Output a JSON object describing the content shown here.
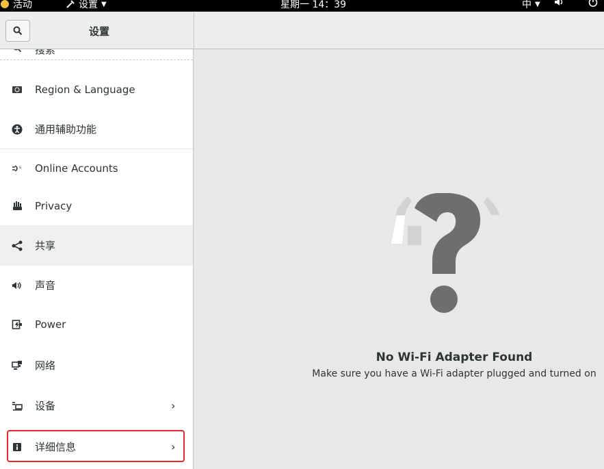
{
  "topbar": {
    "activities": "活动",
    "app_menu": "设置",
    "clock": "星期一 14：39",
    "input_method": "中"
  },
  "header": {
    "title": "设置"
  },
  "sidebar": {
    "items": [
      {
        "label": "搜索",
        "icon": "search-icon"
      },
      {
        "label": "Region & Language",
        "icon": "region-language-icon"
      },
      {
        "label": "通用辅助功能",
        "icon": "accessibility-icon"
      },
      {
        "label": "Online Accounts",
        "icon": "online-accounts-icon"
      },
      {
        "label": "Privacy",
        "icon": "privacy-hand-icon"
      },
      {
        "label": "共享",
        "icon": "share-icon"
      },
      {
        "label": "声音",
        "icon": "sound-icon"
      },
      {
        "label": "Power",
        "icon": "power-battery-icon"
      },
      {
        "label": "网络",
        "icon": "network-icon"
      },
      {
        "label": "设备",
        "icon": "devices-icon",
        "chevron": "›"
      },
      {
        "label": "详细信息",
        "icon": "details-info-icon",
        "chevron": "›"
      }
    ]
  },
  "main": {
    "empty_title": "No Wi-Fi Adapter Found",
    "empty_subtitle": "Make sure you have a Wi-Fi adapter plugged and turned on"
  },
  "colors": {
    "highlight": "#e32b2b",
    "icon_grey": "#6e6e6e"
  }
}
